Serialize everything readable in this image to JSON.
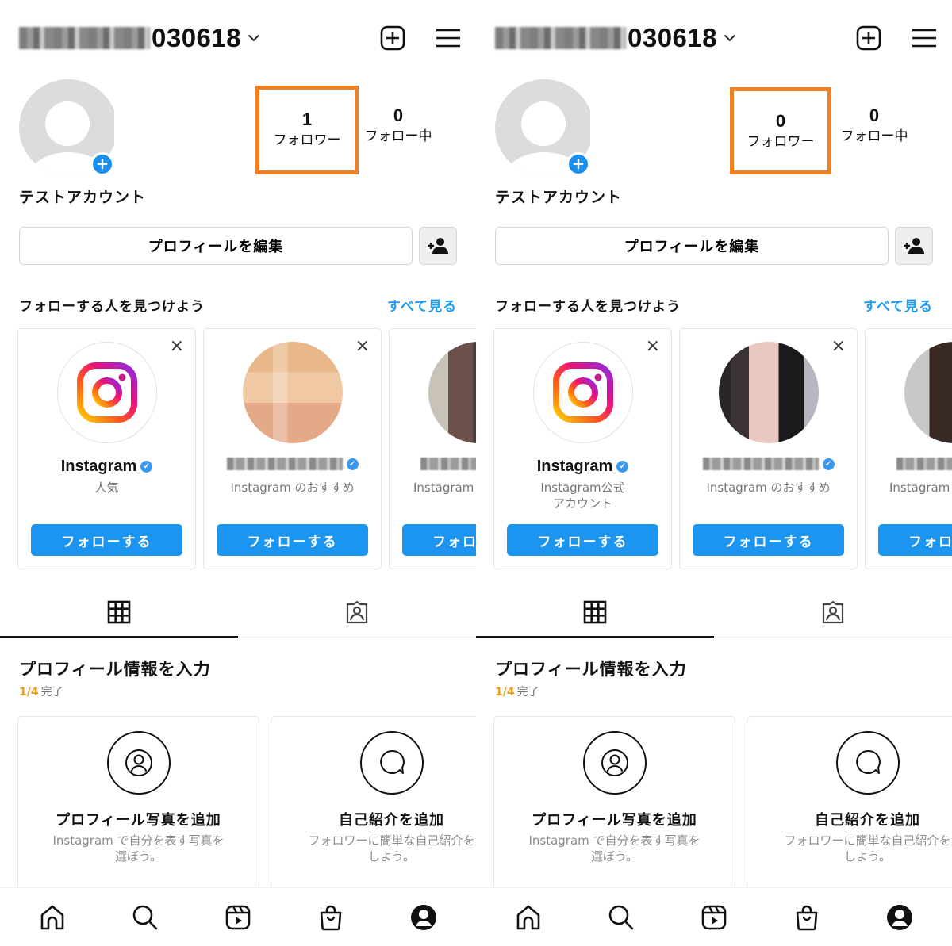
{
  "colors": {
    "highlight_border": "#f08024",
    "follow_button": "#1b95f0",
    "link": "#1b9af0",
    "progress_fraction": "#e89a1a",
    "verified_badge": "#3897f0"
  },
  "panels": [
    {
      "header": {
        "username_visible_suffix": "030618",
        "username_prefix_redacted": true,
        "icons": [
          "new-post-icon",
          "menu-icon"
        ]
      },
      "profile": {
        "display_name": "テストアカウント",
        "stats": {
          "followers": {
            "count": "1",
            "label": "フォロワー",
            "highlighted": true
          },
          "following": {
            "count": "0",
            "label": "フォロー中"
          }
        },
        "edit_profile_label": "プロフィールを編集"
      },
      "suggestions": {
        "title": "フォローする人を見つけよう",
        "see_all": "すべて見る",
        "cards": [
          {
            "name": "Instagram",
            "verified": true,
            "subtitle": "人気",
            "follow_label": "フォローする",
            "avatar": "instagram-logo"
          },
          {
            "name": "",
            "name_redacted": true,
            "verified": true,
            "subtitle": "Instagram のおすすめ",
            "follow_label": "フォローする",
            "avatar": "pixelated-photo"
          },
          {
            "name": "",
            "name_redacted": true,
            "verified": false,
            "subtitle": "Instagram",
            "follow_label": "フォロ",
            "avatar": "pixelated-photo"
          }
        ]
      },
      "tabs": [
        {
          "icon": "grid-icon",
          "active": true
        },
        {
          "icon": "tagged-icon",
          "active": false
        }
      ],
      "completion": {
        "title": "プロフィール情報を入力",
        "progress_fraction": "1/4",
        "progress_label": "完了",
        "cards": [
          {
            "title": "プロフィール写真を追加",
            "description": "Instagram で自分を表す写真を\n選ぼう。",
            "icon": "profile-photo-icon"
          },
          {
            "title": "自己紹介を追加",
            "description": "フォロワーに簡単な自己紹介を\nしよう。",
            "icon": "speech-bubble-icon"
          }
        ]
      }
    },
    {
      "header": {
        "username_visible_suffix": "030618",
        "username_prefix_redacted": true,
        "icons": [
          "new-post-icon",
          "menu-icon"
        ]
      },
      "profile": {
        "display_name": "テストアカウント",
        "stats": {
          "followers": {
            "count": "0",
            "label": "フォロワー",
            "highlighted": true
          },
          "following": {
            "count": "0",
            "label": "フォロー中"
          }
        },
        "edit_profile_label": "プロフィールを編集"
      },
      "suggestions": {
        "title": "フォローする人を見つけよう",
        "see_all": "すべて見る",
        "cards": [
          {
            "name": "Instagram",
            "verified": true,
            "subtitle": "Instagram公式\nアカウント",
            "follow_label": "フォローする",
            "avatar": "instagram-logo"
          },
          {
            "name": "",
            "name_redacted": true,
            "verified": true,
            "subtitle": "Instagram のおすすめ",
            "follow_label": "フォローする",
            "avatar": "pixelated-photo"
          },
          {
            "name": "",
            "name_redacted": true,
            "verified": false,
            "subtitle": "Instagram",
            "follow_label": "フォロ",
            "avatar": "pixelated-photo"
          }
        ]
      },
      "tabs": [
        {
          "icon": "grid-icon",
          "active": true
        },
        {
          "icon": "tagged-icon",
          "active": false
        }
      ],
      "completion": {
        "title": "プロフィール情報を入力",
        "progress_fraction": "1/4",
        "progress_label": "完了",
        "cards": [
          {
            "title": "プロフィール写真を追加",
            "description": "Instagram で自分を表す写真を\n選ぼう。",
            "icon": "profile-photo-icon"
          },
          {
            "title": "自己紹介を追加",
            "description": "フォロワーに簡単な自己紹介を\nしよう。",
            "icon": "speech-bubble-icon"
          }
        ]
      }
    }
  ],
  "bottom_nav": [
    "home-icon",
    "search-icon",
    "reels-icon",
    "shop-icon",
    "profile-icon"
  ],
  "icon_glyphs": {
    "close": "×",
    "plus": "+",
    "verified": "✓"
  }
}
